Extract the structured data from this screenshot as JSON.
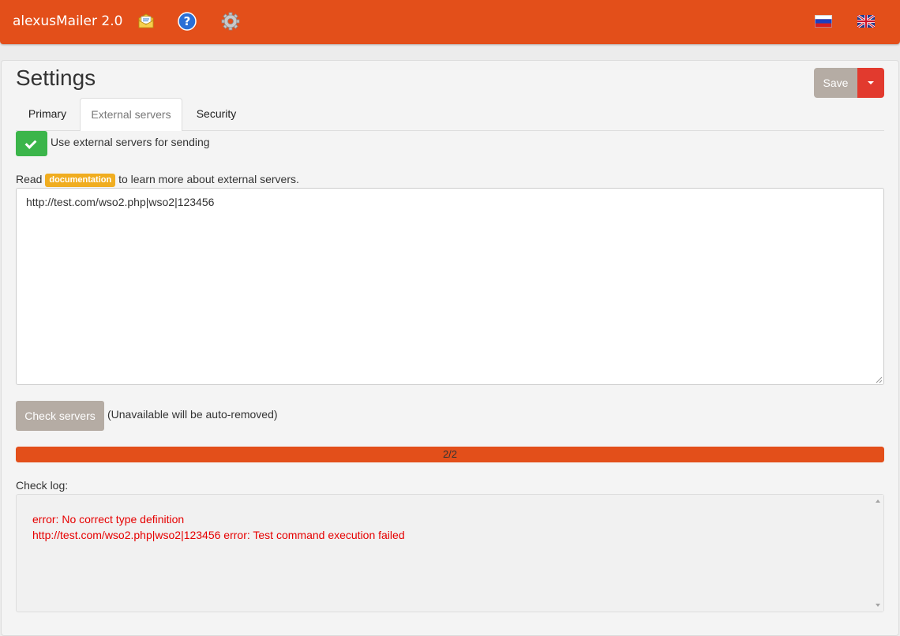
{
  "app": {
    "title": "alexusMailer 2.0"
  },
  "nav": {
    "icons": [
      {
        "name": "mail-icon"
      },
      {
        "name": "help-icon"
      },
      {
        "name": "settings-gear-icon"
      }
    ],
    "flags": [
      {
        "name": "russian-flag-icon"
      },
      {
        "name": "english-flag-icon"
      }
    ]
  },
  "page": {
    "title": "Settings",
    "save_label": "Save",
    "tabs": [
      {
        "label": "Primary",
        "active": false
      },
      {
        "label": "External servers",
        "active": true
      },
      {
        "label": "Security",
        "active": false
      }
    ]
  },
  "external_servers": {
    "use_external_label": "Use external servers for sending",
    "use_external_checked": true,
    "read_prefix": "Read",
    "documentation_badge": "documentation",
    "read_suffix": "to learn more about external servers.",
    "servers_text": "http://test.com/wso2.php|wso2|123456",
    "check_button_label": "Check servers",
    "check_note": "(Unavailable will be auto-removed)",
    "progress": {
      "text": "2/2",
      "fraction": 1.0
    },
    "check_log_label": "Check log:",
    "log_lines": [
      "error: No correct type definition",
      "http://test.com/wso2.php|wso2|123456 error: Test command execution failed"
    ]
  },
  "colors": {
    "navbar": "#e34f1a",
    "success": "#3bb54a",
    "danger": "#e23a2e",
    "warning_badge": "#f0ad20",
    "log_error": "#e60000"
  }
}
